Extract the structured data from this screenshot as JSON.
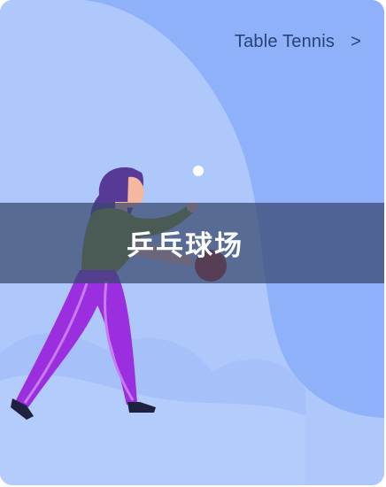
{
  "card": {
    "category_label": "Table Tennis",
    "chevron": ">",
    "title": "乒乓球场"
  },
  "icons": {
    "chevron": "chevron-right-icon",
    "illustration": "table-tennis-player-illustration"
  },
  "colors": {
    "background": "#aec8fb",
    "wave": "#8fb1fa",
    "banner": "#36466e",
    "label": "#27417a",
    "pants": "#9b2fe0",
    "shirt": "#7e8c17",
    "hair": "#573a95",
    "paddle": "#a8281f"
  }
}
